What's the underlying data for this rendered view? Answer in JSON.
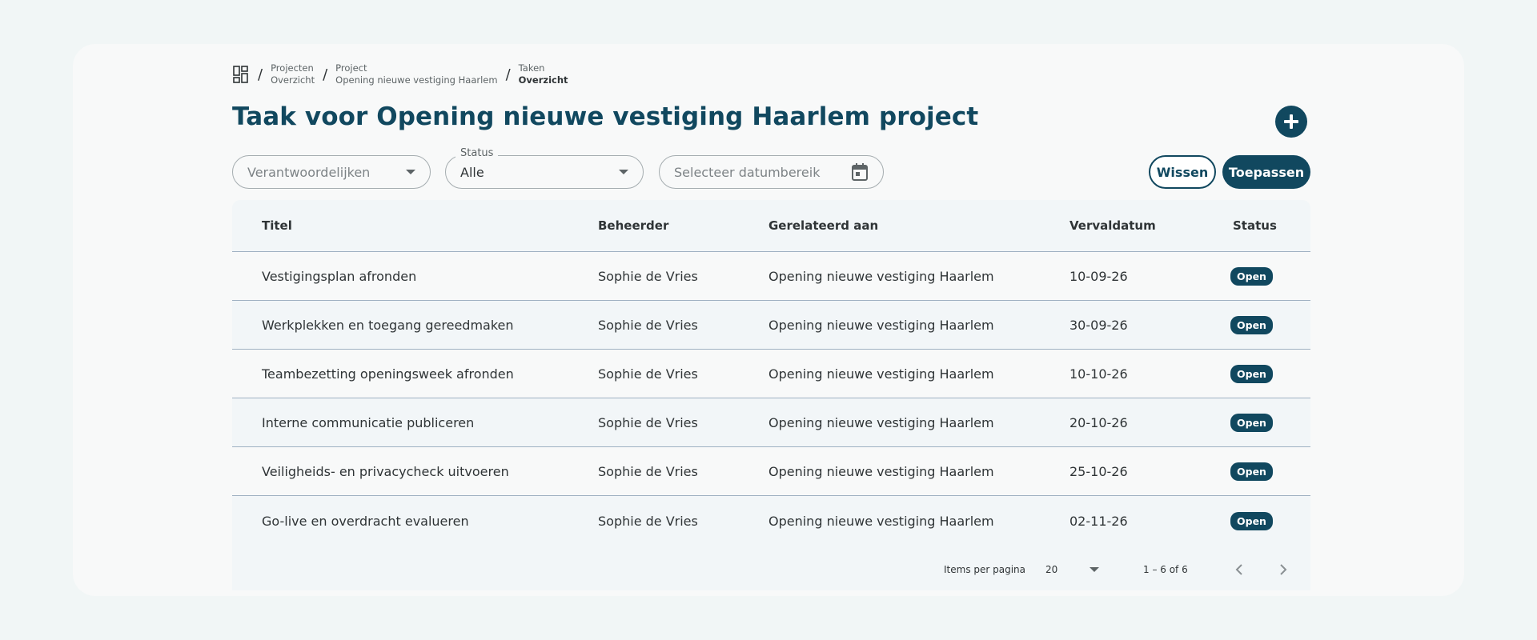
{
  "breadcrumb": {
    "items": [
      {
        "top": "Projecten",
        "bottom": "Overzicht"
      },
      {
        "top": "Project",
        "bottom": "Opening nieuwe vestiging Haarlem"
      },
      {
        "top": "Taken",
        "bottom": "Overzicht"
      }
    ]
  },
  "page": {
    "title": "Taak voor Opening nieuwe vestiging Haarlem project"
  },
  "filters": {
    "owner_placeholder": "Verantwoordelijken",
    "status_label": "Status",
    "status_value": "Alle",
    "date_placeholder": "Selecteer datumbereik",
    "clear_label": "Wissen",
    "apply_label": "Toepassen"
  },
  "table": {
    "headers": {
      "title": "Titel",
      "owner": "Beheerder",
      "related": "Gerelateerd aan",
      "due": "Vervaldatum",
      "status": "Status"
    },
    "rows": [
      {
        "title": "Vestigingsplan afronden",
        "owner": "Sophie de Vries",
        "related": "Opening nieuwe vestiging Haarlem",
        "due": "10-09-26",
        "status": "Open"
      },
      {
        "title": "Werkplekken en toegang gereedmaken",
        "owner": "Sophie de Vries",
        "related": "Opening nieuwe vestiging Haarlem",
        "due": "30-09-26",
        "status": "Open"
      },
      {
        "title": "Teambezetting openingsweek afronden",
        "owner": "Sophie de Vries",
        "related": "Opening nieuwe vestiging Haarlem",
        "due": "10-10-26",
        "status": "Open"
      },
      {
        "title": "Interne communicatie publiceren",
        "owner": "Sophie de Vries",
        "related": "Opening nieuwe vestiging Haarlem",
        "due": "20-10-26",
        "status": "Open"
      },
      {
        "title": "Veiligheids- en privacycheck uitvoeren",
        "owner": "Sophie de Vries",
        "related": "Opening nieuwe vestiging Haarlem",
        "due": "25-10-26",
        "status": "Open"
      },
      {
        "title": "Go-live en overdracht evalueren",
        "owner": "Sophie de Vries",
        "related": "Opening nieuwe vestiging Haarlem",
        "due": "02-11-26",
        "status": "Open"
      }
    ]
  },
  "pagination": {
    "label": "Items per pagina",
    "per_page": "20",
    "range": "1 – 6 of 6"
  },
  "colors": {
    "primary": "#11485f",
    "background": "#f1f6f6",
    "card": "#f8f9f9"
  },
  "icons": {
    "home": "dashboard-icon",
    "add": "plus-icon",
    "calendar": "calendar-icon",
    "prev": "chevron-left-icon",
    "next": "chevron-right-icon"
  }
}
